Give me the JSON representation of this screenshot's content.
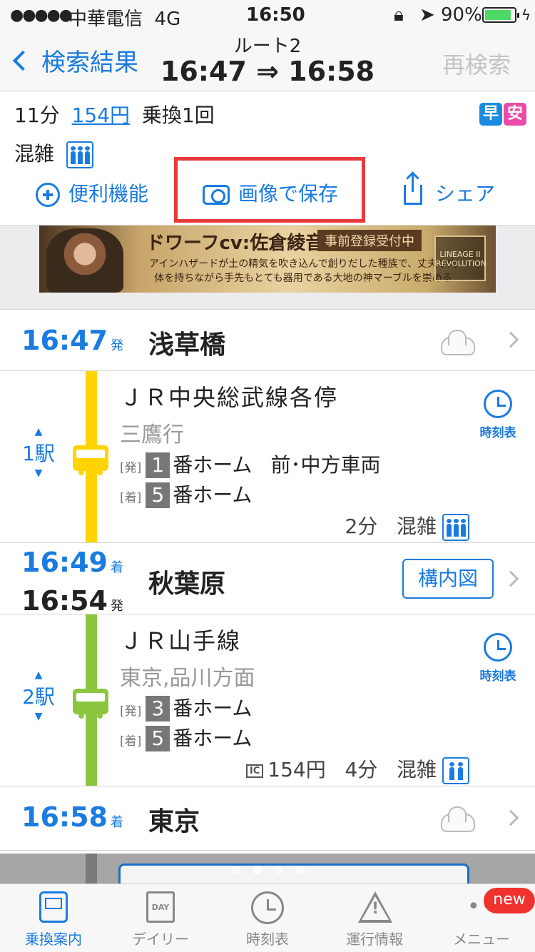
{
  "status_bar": {
    "signal": "●●●●●",
    "carrier": "中華電信",
    "network": "4G",
    "time": "16:50",
    "lock_icon": "rotation-lock-icon",
    "location_icon": "location-arrow-icon",
    "battery_pct": "90%",
    "battery_level": 0.9,
    "charging_icon": "bolt-icon"
  },
  "nav": {
    "back_label": "検索結果",
    "route_label": "ルート2",
    "time_range": "16:47 ⇒ 16:58",
    "research_label": "再検索"
  },
  "summary": {
    "duration": "11分",
    "fare": "154円",
    "transfers": "乗換1回",
    "badge_fast": "早",
    "badge_cheap": "安",
    "crowd_label": "混雑"
  },
  "actions": {
    "utility_label": "便利機能",
    "save_image_label": "画像で保存",
    "share_label": "シェア"
  },
  "ad": {
    "title": "ドワーフcv:佐倉綾音",
    "tag": "事前登録受付中",
    "copy": "アインハザードが土の精気を吹き込んで創りだした種族で、丈夫な肉体を持ちながら手先もとても器用である大地の神マーブルを崇める",
    "logo": "LINEAGE II REVOLUTION"
  },
  "stops": [
    {
      "time1": "16:47",
      "suffix1": "発",
      "name": "浅草橋",
      "weather": "cloudy-icon"
    },
    {
      "time1": "16:49",
      "suffix1": "着",
      "time2": "16:54",
      "suffix2": "発",
      "name": "秋葉原",
      "button": "構内図"
    },
    {
      "time1": "16:58",
      "suffix1": "着",
      "name": "東京",
      "weather": "cloudy-icon"
    }
  ],
  "segments": [
    {
      "line": "ＪＲ中央総武線各停",
      "direction": "三鷹行",
      "color": "#ffd400",
      "stations": "1駅",
      "dep_tag": "[発]",
      "dep_num": "1",
      "dep_text": "番ホーム",
      "dep_extra": "前･中方車両",
      "arr_tag": "[着]",
      "arr_num": "5",
      "arr_text": "番ホーム",
      "meta_fare": "",
      "meta_time": "2分",
      "meta_crowd": "混雑",
      "timetable": "時刻表"
    },
    {
      "line": "ＪＲ山手線",
      "direction": "東京,品川方面",
      "color": "#8cc63f",
      "stations": "2駅",
      "dep_tag": "[発]",
      "dep_num": "3",
      "dep_text": "番ホーム",
      "dep_extra": "",
      "arr_tag": "[着]",
      "arr_num": "5",
      "arr_text": "番ホーム",
      "meta_ic": "IC",
      "meta_fare": "154円",
      "meta_time": "4分",
      "meta_crowd": "混雑",
      "timetable": "時刻表"
    }
  ],
  "pager": {
    "count": 4,
    "active": 2
  },
  "tabs": [
    {
      "label": "乗換案内",
      "icon": "train-icon"
    },
    {
      "label": "デイリー",
      "icon": "day-calendar-icon",
      "icon_text": "DAY"
    },
    {
      "label": "時刻表",
      "icon": "clock-icon"
    },
    {
      "label": "運行情報",
      "icon": "warning-icon"
    },
    {
      "label": "メニュー",
      "icon": "more-dots-icon",
      "icon_text": "•••"
    }
  ],
  "new_badge": "new",
  "colors": {
    "accent": "#1a7be0",
    "highlight": "#e8393d",
    "chuo_line": "#ffd400",
    "yamanote_line": "#8cc63f"
  }
}
